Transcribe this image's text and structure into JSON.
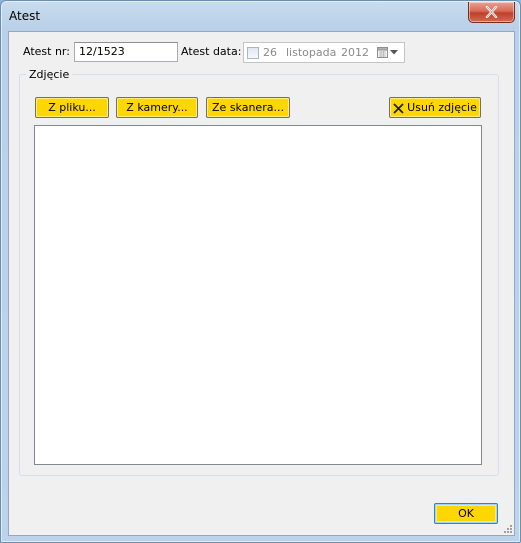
{
  "window": {
    "title": "Atest"
  },
  "form": {
    "atest_nr_label": "Atest nr:",
    "atest_nr_value": "12/1523",
    "atest_data_label": "Atest data:",
    "date": {
      "day": "26",
      "month": "listopada",
      "year": "2012",
      "enabled": false
    }
  },
  "photo_group": {
    "title": "Zdjęcie",
    "buttons": {
      "from_file": "Z pliku...",
      "from_camera": "Z kamery...",
      "from_scanner": "Ze skanera...",
      "remove_photo": "Usuń zdjęcie"
    }
  },
  "footer": {
    "ok_label": "OK"
  },
  "icons": {
    "close": "close-icon",
    "calendar": "calendar-icon",
    "dropdown": "chevron-down-icon",
    "remove": "x-icon",
    "grip": "resize-grip-icon"
  },
  "colors": {
    "button_yellow": "#ffd700",
    "window_frame": "#b9d0e8",
    "close_red": "#c0402a",
    "client_bg": "#f0f0f0"
  }
}
